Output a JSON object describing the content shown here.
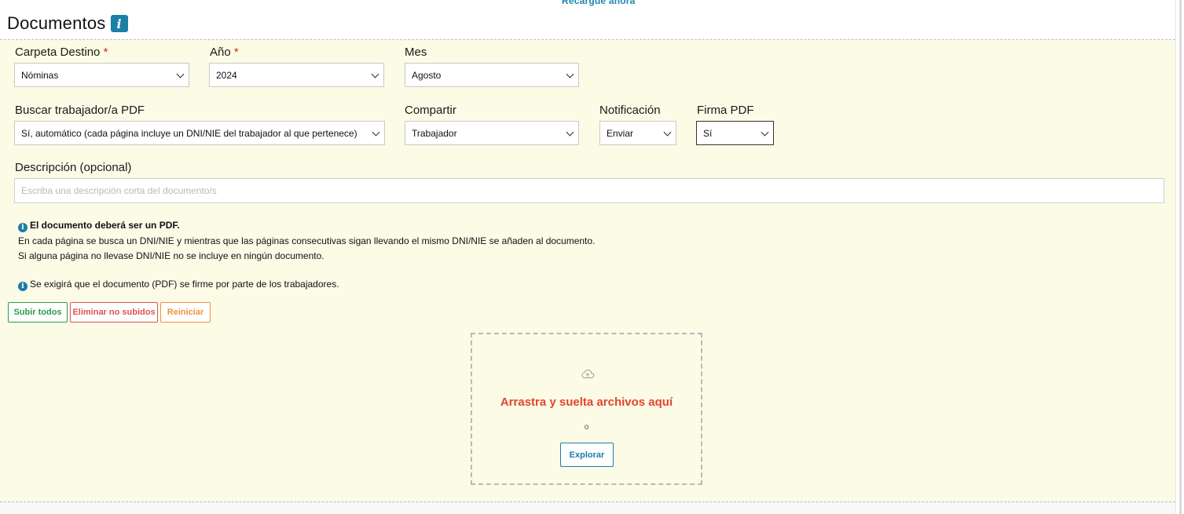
{
  "top_link": "Recargue ahora",
  "header": {
    "title": "Documentos",
    "info_icon": "i"
  },
  "form": {
    "carpeta": {
      "label": "Carpeta Destino",
      "required": "*",
      "value": "Nóminas"
    },
    "anio": {
      "label": "Año",
      "required": "*",
      "value": "2024"
    },
    "mes": {
      "label": "Mes",
      "value": "Agosto"
    },
    "buscar": {
      "label": "Buscar trabajador/a PDF",
      "value": "Sí, automático (cada página incluye un DNI/NIE del trabajador al que pertenece)"
    },
    "compartir": {
      "label": "Compartir",
      "value": "Trabajador"
    },
    "notificacion": {
      "label": "Notificación",
      "value": "Enviar"
    },
    "firma": {
      "label": "Firma PDF",
      "value": "Sí"
    },
    "descripcion": {
      "label": "Descripción (opcional)",
      "placeholder": "Escriba una descripción corta del documento/s",
      "value": ""
    }
  },
  "notes": {
    "pdf_title": "El documento deberá ser un PDF.",
    "pdf_line1": "En cada página se busca un DNI/NIE y mientras que las páginas consecutivas sigan llevando el mismo DNI/NIE se añaden al documento.",
    "pdf_line2": "Si alguna página no llevase DNI/NIE no se incluye en ningún documento.",
    "firma_note": "Se exigirá que el documento (PDF) se firme por parte de los trabajadores."
  },
  "buttons": {
    "upload_all": "Subir todos",
    "delete_unuploaded": "Eliminar no subidos",
    "reset": "Reiniciar"
  },
  "dropzone": {
    "icon": "cloud-upload-icon",
    "text": "Arrastra y suelta archivos aquí",
    "or": "o",
    "browse": "Explorar"
  },
  "colors": {
    "accent": "#1b7fa6",
    "panel_bg": "#fbfbe6",
    "green": "#2a9d4a",
    "red": "#e05252",
    "orange": "#f0933a",
    "drop_text": "#e2462d"
  }
}
